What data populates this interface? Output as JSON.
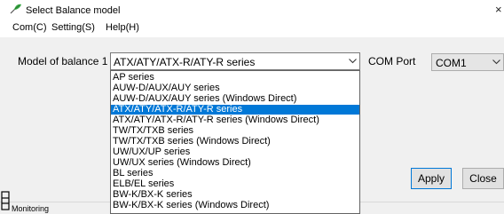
{
  "window": {
    "title": "Select Balance model",
    "close_glyph": "×",
    "icon": "feather-pen-icon",
    "accent_color": "#0078d7"
  },
  "menu": {
    "items": [
      "Com(C)",
      "Setting(S)",
      "Help(H)"
    ]
  },
  "model": {
    "label": "Model of balance 1",
    "selected": "ATX/ATY/ATX-R/ATY-R series",
    "options": [
      "AP series",
      "AUW-D/AUX/AUY series",
      "AUW-D/AUX/AUY series (Windows Direct)",
      "ATX/ATY/ATX-R/ATY-R series",
      "ATX/ATY/ATX-R/ATY-R series (Windows Direct)",
      "TW/TX/TXB series",
      "TW/TX/TXB series (Windows Direct)",
      "UW/UX/UP series",
      "UW/UX series (Windows Direct)",
      "BL series",
      "ELB/EL series",
      "BW-K/BX-K series",
      "BW-K/BX-K series (Windows Direct)"
    ],
    "highlighted_index": 3
  },
  "com_port": {
    "label": "COM Port",
    "value": "COM1"
  },
  "buttons": {
    "apply": "Apply",
    "close": "Close"
  },
  "status": {
    "text": "Monitoring",
    "icon_glyph": "日"
  }
}
